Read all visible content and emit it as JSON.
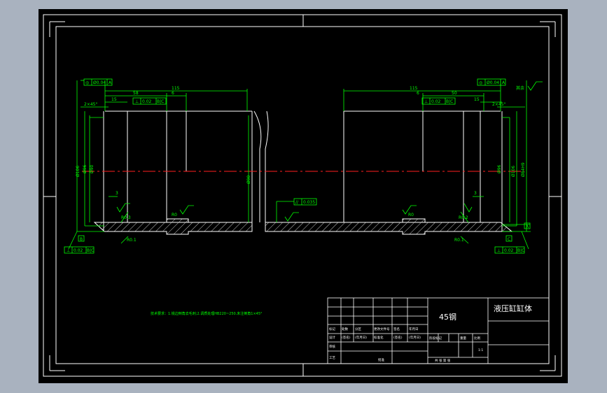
{
  "colors": {
    "background": "#000000",
    "frame": "#ffffff",
    "dimension": "#00ff00",
    "annotation": "#00ff00",
    "centerline": "#ff2020",
    "hatch": "#c8c8c8",
    "window": "#a9b2bf"
  },
  "dimensions": {
    "left_115": "115",
    "left_58": "58",
    "left_6": "6",
    "left_15": "15",
    "left_chamfer": "2×45°",
    "left_dia_106": "Ø106",
    "left_dia_96": "Ø96",
    "left_dia_90": "Ø90",
    "left_3": "3",
    "left_r03": "R0.3",
    "left_r01": "R0.1",
    "left_r0": "R0",
    "right_115": "115",
    "right_50": "50",
    "right_6": "6",
    "right_15": "15",
    "right_chamfer": "2×45°",
    "right_dia_96": "Ø96",
    "right_dia_106": "Ø106",
    "right_dia_h9": "Ø84H9",
    "right_3": "3",
    "right_r02": "R0.2",
    "right_r01": "R0.1",
    "right_r0": "R0",
    "center_dia": "Ø90"
  },
  "tolerances": {
    "tl_top_sym": "◎",
    "tl_top_val": "Ø0.04",
    "tl_top_ref": "A",
    "tl_mid_sym": "⊥",
    "tl_mid_val": "0.02",
    "tl_mid_ref": "B|C",
    "tl_bot_sym": "⊥",
    "tl_bot_val": "0.02",
    "tl_bot_ref": "B|C",
    "tr_top_sym": "◎",
    "tr_top_val": "Ø0.04",
    "tr_top_ref": "A",
    "tr_mid_sym": "⊥",
    "tr_mid_val": "0.02",
    "tr_mid_ref": "B|C",
    "tr_bot_sym": "⊥",
    "tr_bot_val": "0.02",
    "tr_bot_ref": "B|C",
    "center_sym": "//",
    "center_val": "0.035",
    "datum_b": "B",
    "datum_c": "C",
    "datum_a": "A",
    "note_top_right": "其余"
  },
  "tech_note": "技术要求：1.锐边倒角去毛刺;2.调质处理HB220~250.未注倒角1×45°",
  "title_block": {
    "material": "45钢",
    "part_name": "液压缸缸体",
    "small_cells": {
      "r3c1": "标记",
      "r3c2": "处数",
      "r3c3": "分区",
      "r3c4": "更改文件号",
      "r3c5": "签名",
      "r3c6": "年月日",
      "r4c1": "设计",
      "r4c2": "(签名)",
      "r4c3": "(年月日)",
      "r4c4": "标准化",
      "r4c5": "(签名)",
      "r4c6": "(年月日)",
      "r5c1": "审核",
      "r6c1": "工艺",
      "r6c4": "批准",
      "mid_r1": "阶段标记",
      "mid_r1b": "重量",
      "mid_r1c": "比例",
      "mid_scale": "1:1",
      "mid_bottom": "共 张 第 张"
    }
  }
}
